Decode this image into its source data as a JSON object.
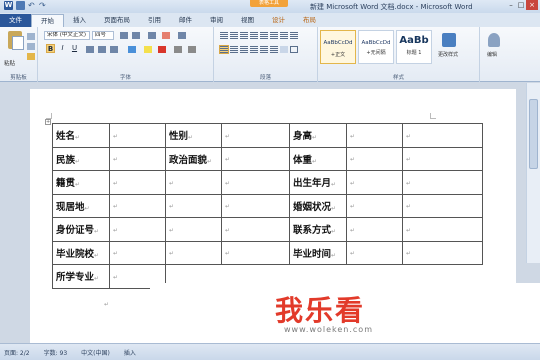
{
  "window": {
    "title": "新建 Microsoft Word 文档.docx - Microsoft Word",
    "contextual_tab": "表格工具",
    "qat": {
      "logo": "W",
      "undo": "↶",
      "redo": "↷"
    },
    "controls": {
      "minimize": "–",
      "maximize": "□",
      "close": "×"
    }
  },
  "tabs": [
    "文件",
    "开始",
    "插入",
    "页面布局",
    "引用",
    "邮件",
    "审阅",
    "视图",
    "设计",
    "布局"
  ],
  "ribbon": {
    "clipboard": {
      "paste": "粘贴",
      "label": "剪贴板"
    },
    "font": {
      "name": "宋体 (中文正文)",
      "size": "四号",
      "label": "字体",
      "bold": "B",
      "italic": "I",
      "underline": "U"
    },
    "paragraph": {
      "label": "段落"
    },
    "styles": {
      "label": "样式",
      "cards": [
        {
          "sample": "AaBbCcDd",
          "name": "+正文"
        },
        {
          "sample": "AaBbCcDd",
          "name": "+无间隔"
        },
        {
          "sample": "AaBb",
          "name": "标题 1"
        }
      ],
      "change_styles": "更改样式",
      "edit": "编辑"
    }
  },
  "document": {
    "cell_mark": "↵",
    "rows": [
      [
        "姓名",
        "",
        "性别",
        "",
        "身高",
        "",
        ""
      ],
      [
        "民族",
        "",
        "政治面貌",
        "",
        "体重",
        "",
        ""
      ],
      [
        "籍贯",
        "",
        "",
        "",
        "出生年月",
        "",
        ""
      ],
      [
        "现居地",
        "",
        "",
        "",
        "婚姻状况",
        "",
        ""
      ],
      [
        "身份证号",
        "",
        "",
        "",
        "联系方式",
        "",
        ""
      ],
      [
        "毕业院校",
        "",
        "",
        "",
        "毕业时间",
        "",
        ""
      ],
      [
        "所学专业",
        ""
      ]
    ]
  },
  "watermark": {
    "text": "我乐看",
    "url": "www.woleken.com"
  },
  "statusbar": {
    "page": "页面: 2/2",
    "words": "字数: 93",
    "lang": "中文(中国)",
    "mode": "插入"
  }
}
